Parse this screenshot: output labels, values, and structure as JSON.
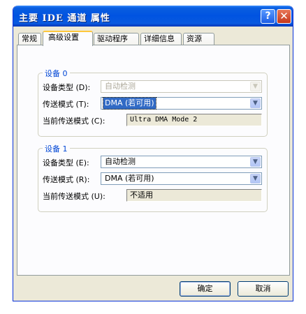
{
  "window": {
    "title": "主要 IDE 通道 属性"
  },
  "titlebar_buttons": {
    "help": "?",
    "close": "✕"
  },
  "tabs": [
    {
      "label": "常规"
    },
    {
      "label": "高级设置"
    },
    {
      "label": "驱动程序"
    },
    {
      "label": "详细信息"
    },
    {
      "label": "资源"
    }
  ],
  "active_tab": "高级设置",
  "device0": {
    "legend": "设备 0",
    "type_label": "设备类型 (D):",
    "type_value": "自动检测",
    "mode_label": "传送模式 (T):",
    "mode_value": "DMA (若可用)",
    "current_label": "当前传送模式 (C):",
    "current_value": "Ultra DMA Mode 2"
  },
  "device1": {
    "legend": "设备 1",
    "type_label": "设备类型 (E):",
    "type_value": "自动检测",
    "mode_label": "传送模式 (R):",
    "mode_value": "DMA (若可用)",
    "current_label": "当前传送模式 (U):",
    "current_value": "不适用"
  },
  "buttons": {
    "ok": "确定",
    "cancel": "取消"
  },
  "colors": {
    "title_bar": "#0053e1",
    "legend": "#0046d5",
    "selection": "#316ac5",
    "active_tab_accent": "#ffc83c"
  }
}
